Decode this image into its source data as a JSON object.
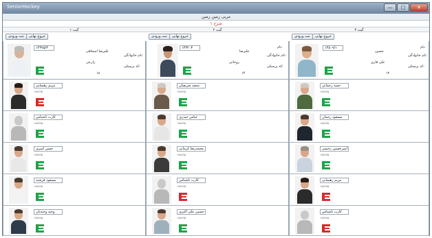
{
  "window": {
    "title": "SeniorHockey",
    "minimize": "—",
    "maximize": "□",
    "close": "✕"
  },
  "header": {
    "title": "مربی زمین زمین"
  },
  "subtitle": "شرح ۱",
  "columns": [
    {
      "label": "گیت ۱",
      "buttons": [
        "خروج نهایی",
        "ثبت ورودی"
      ]
    },
    {
      "label": "گیت ۲",
      "buttons": [
        "خروج نهایی",
        "ثبت ورودی"
      ]
    },
    {
      "label": "گیت ۳",
      "buttons": [
        "خروج نهایی",
        "ثبت ورودی"
      ]
    }
  ],
  "big_cards": [
    {
      "code": "۱۴۳۷۵/۳",
      "name": "علیرضا اسحاقی",
      "name_label": "نام:",
      "father_label": "نام خانوادگی:",
      "father": "زارعی",
      "member_label": "کد پرسنلی:",
      "member": "۱۸"
    },
    {
      "code": "۱۴۳۲۰۳",
      "name": "علیرضا",
      "name_label": "نام:",
      "father_label": "نام خانوادگی:",
      "father": "روحانی",
      "member_label": "کد پرسنلی:",
      "member": "۱۴"
    },
    {
      "code": "۱۴۵۰۹/۱",
      "name": "حسین",
      "name_label": "نام:",
      "father_label": "نام خانوادگی:",
      "father": "علی قاری",
      "member_label": "کد پرسنلی:",
      "member": "۱۲"
    }
  ],
  "grid": [
    [
      {
        "name": "مریم رهنمایی",
        "id": "۱۹۸۷۶۵"
      },
      {
        "name": "کارت ناشناس",
        "id": "۱۹۸۷۶۵"
      },
      {
        "name": "حسن امیری",
        "id": "۱۹۸۷۶۵"
      },
      {
        "name": "مسعود فرشته",
        "id": "۱۹۸۷۶۵"
      },
      {
        "name": "وحید وحیدیان",
        "id": "۱۹۸۷۶۵"
      }
    ],
    [
      {
        "name": "سعید شریفیان",
        "id": "۱۹۸۷۶۵"
      },
      {
        "name": "عباس حیدری",
        "id": "۱۹۸۷۶۵"
      },
      {
        "name": "محمدرضا کرمانی",
        "id": "۱۹۸۷۶۵"
      },
      {
        "name": "کارت ناشناس",
        "id": "۱۹۸۷۶۵"
      },
      {
        "name": "حسین علی اکبری",
        "id": "۱۹۸۷۶۵"
      }
    ],
    [
      {
        "name": "حمید رحمانی",
        "id": "۱۹۸۷۶۵"
      },
      {
        "name": "مسعود رحمان",
        "id": "۱۹۸۷۶۵"
      },
      {
        "name": "امیرحسین رحیمی",
        "id": "۱۹۸۷۶۵"
      },
      {
        "name": "مریم رهنمایی",
        "id": "۱۹۸۷۶۵"
      },
      {
        "name": "کارت ناشناس",
        "id": "۱۹۸۷۶۵"
      }
    ]
  ],
  "colors": {
    "accent_red": "#c0392b",
    "icon_green": "#1fa34a",
    "icon_red": "#d62b2b"
  }
}
